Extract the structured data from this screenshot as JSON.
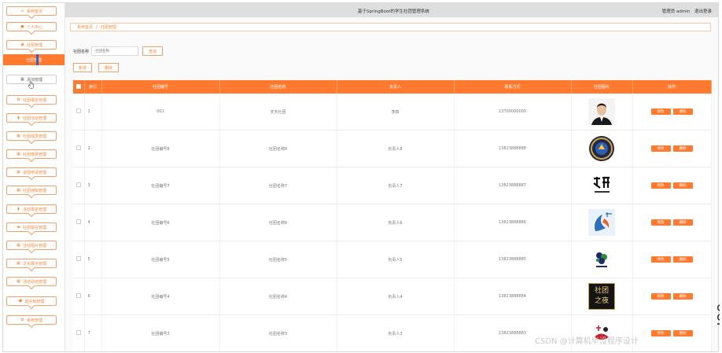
{
  "header": {
    "title": "基于SpringBoot的学生社团管理系统",
    "user": "管理员 admin",
    "logout": "退出登录"
  },
  "sidebar": {
    "items": [
      {
        "label": "系统首页",
        "icon": "home-icon"
      },
      {
        "label": "个人中心",
        "icon": "user-icon"
      },
      {
        "label": "社团管理",
        "icon": "lock-icon"
      },
      {
        "label": "社团管理",
        "icon": ""
      },
      {
        "label": "添加管理",
        "icon": "grid-icon"
      },
      {
        "label": "社团报名管理",
        "icon": "gear-icon"
      },
      {
        "label": "社团活动管理",
        "icon": "chart-icon"
      },
      {
        "label": "社团成员管理",
        "icon": "grid-icon"
      },
      {
        "label": "社团缴费管理",
        "icon": "grid-icon"
      },
      {
        "label": "退团申请管理",
        "icon": "grid-icon"
      },
      {
        "label": "社团通知管理",
        "icon": "grid-icon"
      },
      {
        "label": "活动报名管理",
        "icon": "chart-icon"
      },
      {
        "label": "社团留言管理",
        "icon": "message-icon"
      },
      {
        "label": "活动图片管理",
        "icon": "grid-icon"
      },
      {
        "label": "文化展示管理",
        "icon": "grid-icon"
      },
      {
        "label": "活动总结管理",
        "icon": "grid-icon"
      },
      {
        "label": "留言板管理",
        "icon": "shield-icon"
      },
      {
        "label": "系统管理",
        "icon": "gear-icon"
      }
    ]
  },
  "breadcrumb": {
    "home": "系统首页",
    "sep": "/",
    "current": "社团管理"
  },
  "search": {
    "label": "社团名称",
    "placeholder": "社团名称",
    "button": "查询"
  },
  "actions": {
    "add": "新增",
    "delete": "删除"
  },
  "table": {
    "headers": [
      "索引",
      "社团编号",
      "社团名称",
      "负责人",
      "联系方式",
      "社团图片",
      "操作"
    ],
    "rows": [
      {
        "index": "1",
        "code": "001",
        "name": "天天社团",
        "leader": "李四",
        "phone": "13700000000",
        "image": "portrait"
      },
      {
        "index": "2",
        "code": "社团编号8",
        "name": "社团名称8",
        "leader": "负责人8",
        "phone": "13823888888",
        "image": "round-badge"
      },
      {
        "index": "3",
        "code": "社团编号7",
        "name": "社团名称7",
        "leader": "负责人7",
        "phone": "13823888887",
        "image": "calligraphy"
      },
      {
        "index": "4",
        "code": "社团编号6",
        "name": "社团名称6",
        "leader": "负责人6",
        "phone": "13823888886",
        "image": "blue-emblem"
      },
      {
        "index": "5",
        "code": "社团编号5",
        "name": "社团名称5",
        "leader": "负责人5",
        "phone": "13823888885",
        "image": "green-logo"
      },
      {
        "index": "6",
        "code": "社团编号4",
        "name": "社团名称4",
        "leader": "负责人4",
        "phone": "13823888884",
        "image": "club-sign",
        "image_text": "社团\n之夜"
      },
      {
        "index": "7",
        "code": "社团编号3",
        "name": "社团名称3",
        "leader": "负责人3",
        "phone": "13823888883",
        "image": "red-logo"
      }
    ],
    "row_actions": {
      "edit": "修改",
      "delete": "删除"
    }
  },
  "watermark": "CSDN @计算机毕设程序设计",
  "colors": {
    "accent": "#ff7a2f",
    "header_bg": "#dedede"
  }
}
